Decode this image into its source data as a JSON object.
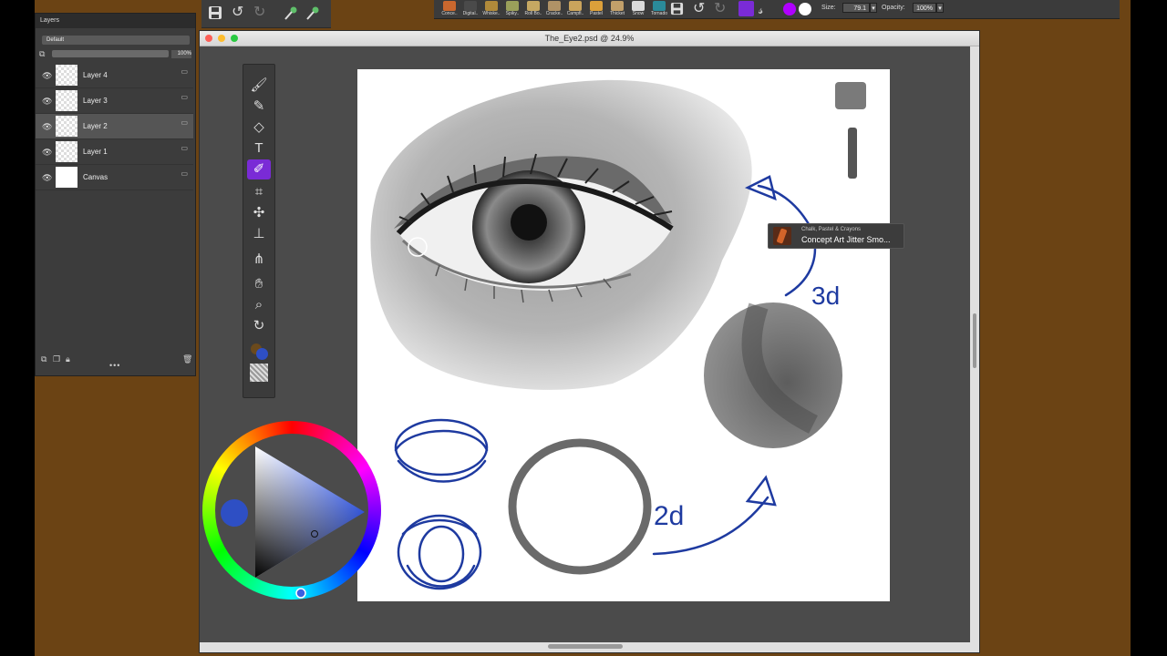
{
  "top_toolbar_left": {
    "icons": [
      "save-icon",
      "undo-icon",
      "redo-icon",
      "brush-tip-icon",
      "brush-tip-icon"
    ]
  },
  "brush_bar": {
    "presets": [
      "Conce..",
      "Digital..",
      "Whiske..",
      "Spiky..",
      "Roll Bo..",
      "Cracke..",
      "Campfi..",
      "Pastel",
      "Thicket",
      "Snow",
      "Tornado"
    ],
    "size_label": "Size:",
    "size_value": "79.1",
    "opacity_label": "Opacity:",
    "opacity_value": "100%",
    "colors": {
      "primary": "#b000ff",
      "secondary": "#ffffff"
    }
  },
  "layers_panel": {
    "title": "Layers",
    "blend_mode": "Default",
    "opacity": "100%",
    "layers": [
      {
        "name": "Layer 4"
      },
      {
        "name": "Layer 3"
      },
      {
        "name": "Layer 2"
      },
      {
        "name": "Layer 1"
      },
      {
        "name": "Canvas"
      }
    ],
    "selected": "Layer 2"
  },
  "document": {
    "title": "The_Eye2.psd @ 24.9%"
  },
  "canvas_text": {
    "label_3d": "3d",
    "label_2d": "2d"
  },
  "tooltip": {
    "category": "Chalk, Pastel & Crayons",
    "brush": "Concept Art Jitter Smo..."
  },
  "colors": {
    "desktop": "#6b4314",
    "accent": "#7a2bd6",
    "ink": "#1e3aa0",
    "current_color": "#2e4fc4"
  }
}
